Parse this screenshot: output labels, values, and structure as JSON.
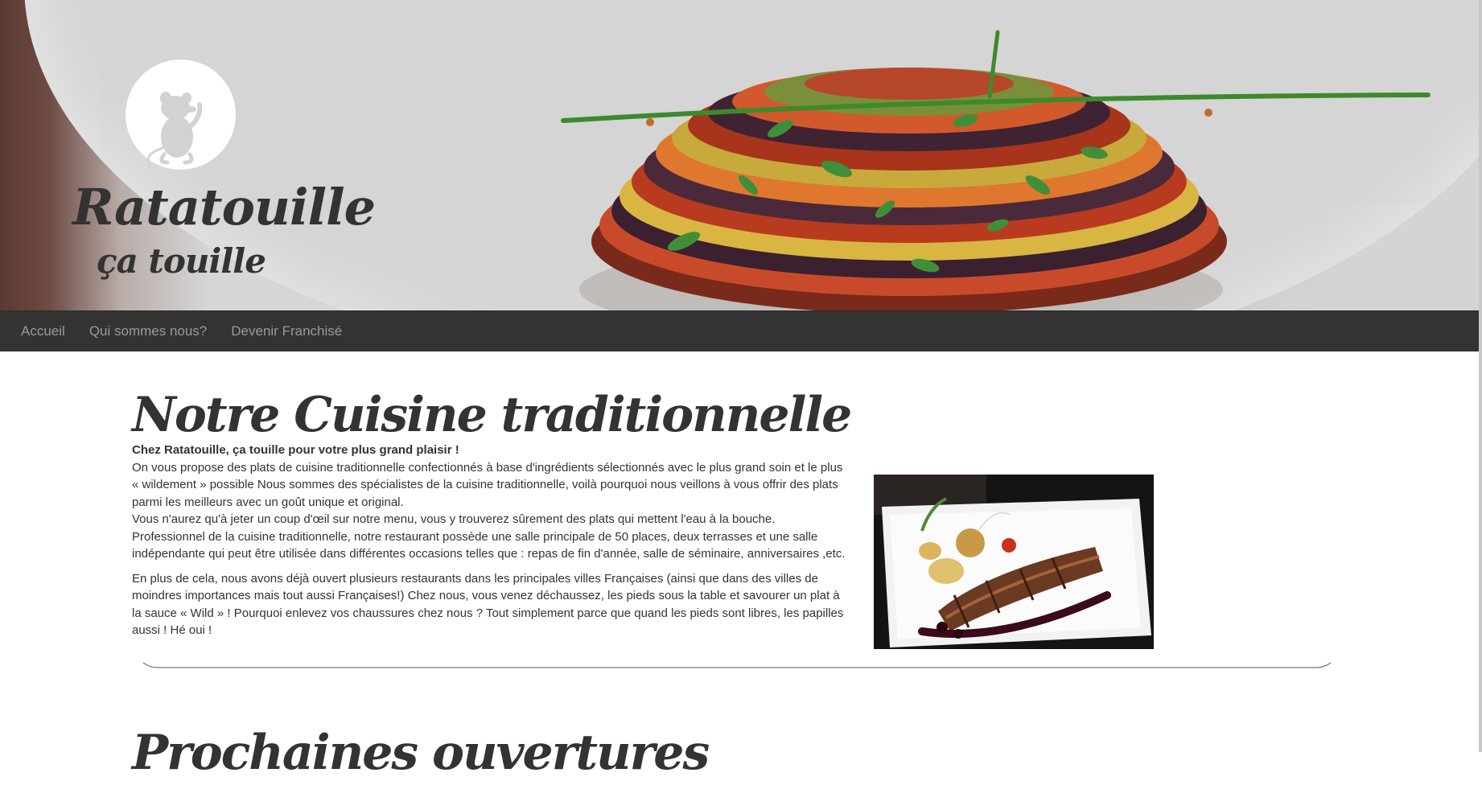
{
  "brand": {
    "name": "Ratatouille",
    "tagline": "ça touille"
  },
  "nav": {
    "items": [
      {
        "label": "Accueil"
      },
      {
        "label": "Qui sommes nous?"
      },
      {
        "label": "Devenir Franchisé"
      }
    ]
  },
  "main": {
    "title": "Notre Cuisine traditionnelle",
    "lead": "Chez Ratatouille, ça touille pour votre plus grand plaisir !",
    "paragraph1": "On vous propose des plats de cuisine traditionnelle confectionnés à base d'ingrédients sélectionnés avec le plus grand soin et le plus « wildement » possible Nous sommes des spécialistes de la cuisine traditionnelle, voilà pourquoi nous veillons à vous offrir des plats parmi les meilleurs avec un goût unique et original.",
    "paragraph2": "Vous n'aurez qu'à jeter un coup d'œil sur notre menu, vous y trouverez sûrement des plats qui mettent l'eau à la bouche. Professionnel de la cuisine traditionnelle, notre restaurant possède une salle principale de 50 places, deux terrasses et une salle indépendante qui peut être utilisée dans différentes occasions telles que : repas de fin d'année, salle de séminaire, anniversaires ,etc.",
    "paragraph3": "En plus de cela, nous avons déjà ouvert plusieurs restaurants dans les principales villes Françaises (ainsi que dans des villes de moindres importances mais tout aussi Françaises!) Chez nous, vous venez déchaussez, les pieds sous la table et savourer un plat à la sauce « Wild » ! Pourquoi enlevez vos chaussures chez nous ? Tout simplement parce que quand les pieds sont libres, les papilles aussi ! Hé oui !",
    "next_title": "Prochaines ouvertures"
  },
  "colors": {
    "navbar": "#333333",
    "nav_link": "#9a9a9a",
    "text": "#333333"
  },
  "icons": {
    "logo": "rat-silhouette-icon"
  }
}
